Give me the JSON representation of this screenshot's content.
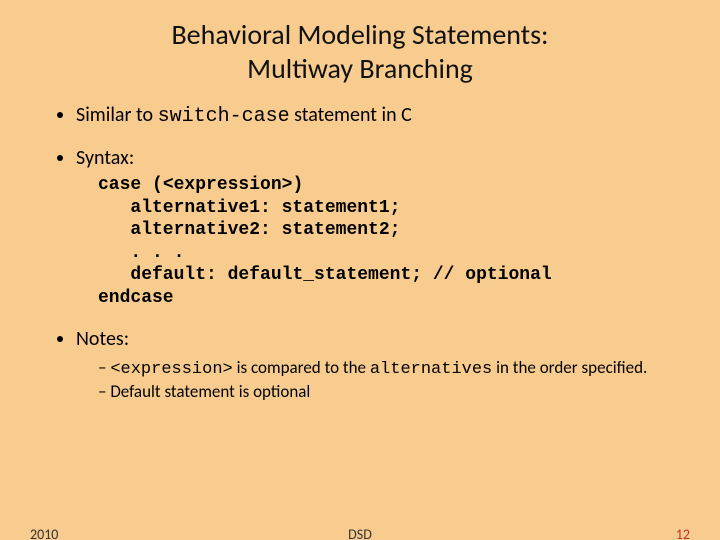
{
  "title_line1": "Behavioral Modeling Statements:",
  "title_line2": "Multiway Branching",
  "bullet1_pre": "Similar to ",
  "bullet1_mono": "switch-case",
  "bullet1_post": " statement in C",
  "bullet2": "Syntax:",
  "code_l1a": "case",
  "code_l1b": " (<expression>)",
  "code_l2": "   alternative1: statement1;",
  "code_l3": "   alternative2: statement2;",
  "code_l4": "   . . .",
  "code_l5a": "   default:",
  "code_l5b": " default_statement; ",
  "code_l5c": "// optional",
  "code_l6": "endcase",
  "bullet3": "Notes:",
  "note1_a": "<expression>",
  "note1_b": " is compared to the ",
  "note1_c": "alternatives",
  "note1_d": " in the order specified.",
  "note2": "Default statement is optional",
  "footer_left": "2010",
  "footer_center": "DSD",
  "footer_right": "12"
}
